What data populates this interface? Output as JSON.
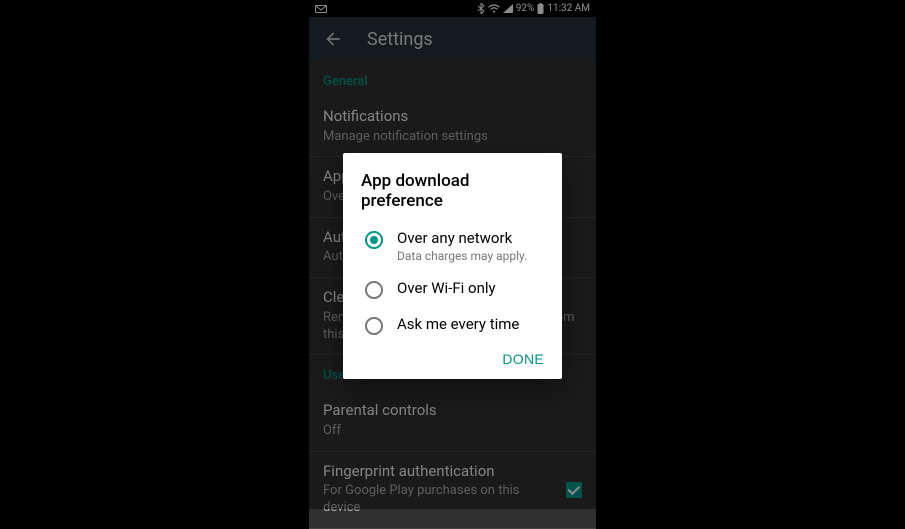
{
  "status": {
    "battery_pct": "92%",
    "time": "11:32 AM"
  },
  "appbar": {
    "title": "Settings"
  },
  "sections": {
    "general": {
      "header": "General",
      "notifications": {
        "title": "Notifications",
        "sub": "Manage notification settings"
      },
      "app_download": {
        "title": "App download preference",
        "sub": "Over any network"
      },
      "auto_update": {
        "title": "Auto-update apps",
        "sub": "Auto-update apps over Wi-Fi only."
      },
      "clear_search": {
        "title": "Clear local search history",
        "sub": "Remove searches you have performed from this device"
      }
    },
    "user_controls": {
      "header": "User controls",
      "parental": {
        "title": "Parental controls",
        "sub": "Off"
      },
      "fingerprint": {
        "title": "Fingerprint authentication",
        "sub": "For Google Play purchases on this device",
        "checked": true
      }
    }
  },
  "dialog": {
    "title": "App download preference",
    "options": [
      {
        "label": "Over any network",
        "sub": "Data charges may apply.",
        "selected": true
      },
      {
        "label": "Over Wi-Fi only",
        "selected": false
      },
      {
        "label": "Ask me every time",
        "selected": false
      }
    ],
    "done": "DONE"
  }
}
